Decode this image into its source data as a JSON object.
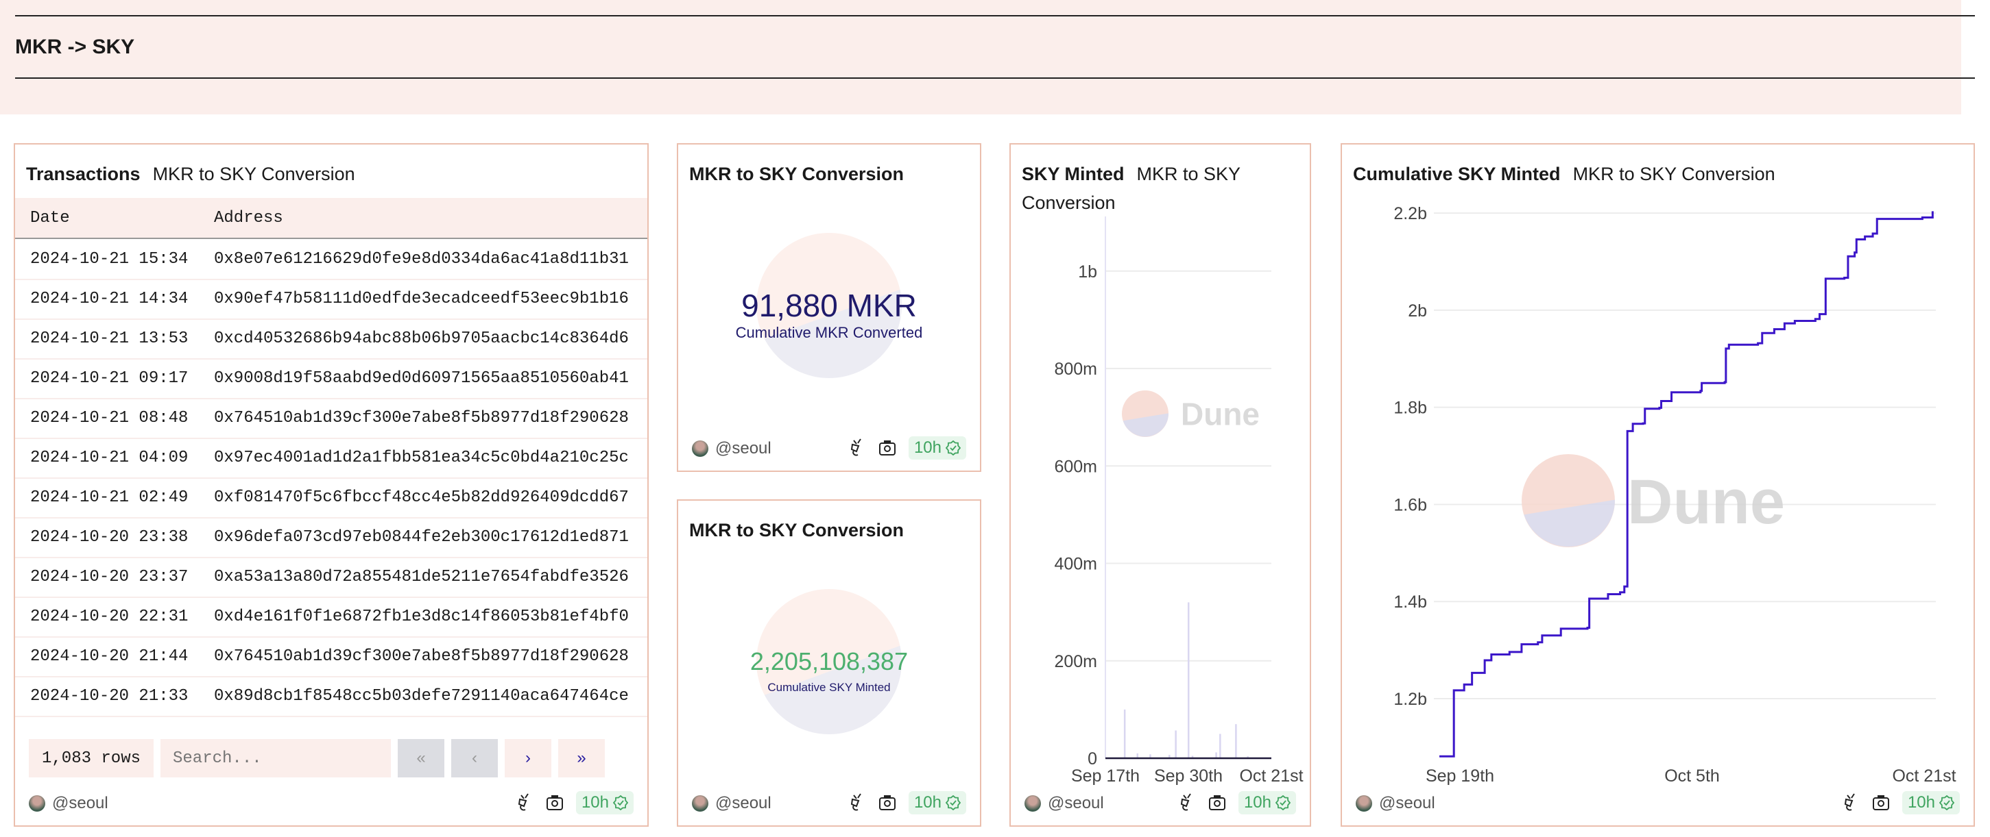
{
  "header": {
    "title": "MKR -> SKY"
  },
  "colors": {
    "accent": "#2a1fa0",
    "line": "#3b16c9",
    "bar": "#d9d6f0",
    "green": "#4caf6e",
    "navy": "#1f1a6b",
    "card_border": "#ebbfae",
    "header_bg": "#fbeeeb"
  },
  "table_card": {
    "title": "Transactions",
    "subtitle": "MKR to SKY Conversion",
    "columns": [
      "Date",
      "Address"
    ],
    "rows": [
      [
        "2024-10-21 15:34",
        "0x8e07e61216629d0fe9e8d0334da6ac41a8d11b31"
      ],
      [
        "2024-10-21 14:34",
        "0x90ef47b58111d0edfde3ecadceedf53eec9b1b16"
      ],
      [
        "2024-10-21 13:53",
        "0xcd40532686b94abc88b06b9705aacbc14c8364d6"
      ],
      [
        "2024-10-21 09:17",
        "0x9008d19f58aabd9ed0d60971565aa8510560ab41"
      ],
      [
        "2024-10-21 08:48",
        "0x764510ab1d39cf300e7abe8f5b8977d18f290628"
      ],
      [
        "2024-10-21 04:09",
        "0x97ec4001ad1d2a1fbb581ea34c5c0bd4a210c25c"
      ],
      [
        "2024-10-21 02:49",
        "0xf081470f5c6fbccf48cc4e5b82dd926409dcdd67"
      ],
      [
        "2024-10-20 23:38",
        "0x96defa073cd97eb0844fe2eb300c17612d1ed871"
      ],
      [
        "2024-10-20 23:37",
        "0xa53a13a80d72a855481de5211e7654fabdfe3526"
      ],
      [
        "2024-10-20 22:31",
        "0xd4e161f0f1e6872fb1e3d8c14f86053b81ef4bf0"
      ],
      [
        "2024-10-20 21:44",
        "0x764510ab1d39cf300e7abe8f5b8977d18f290628"
      ],
      [
        "2024-10-20 21:33",
        "0x89d8cb1f8548cc5b03defe7291140aca647464ce"
      ]
    ],
    "row_count": "1,083 rows",
    "search_placeholder": "Search...",
    "pager": {
      "first": "«",
      "prev": "‹",
      "next": "›",
      "last": "»"
    },
    "author": "@seoul",
    "freshness": "10h"
  },
  "counter1": {
    "title": "MKR to SKY Conversion",
    "value": "91,880 MKR",
    "label": "Cumulative MKR Converted",
    "author": "@seoul",
    "freshness": "10h"
  },
  "counter2": {
    "title": "MKR to SKY Conversion",
    "value": "2,205,108,387",
    "label": "Cumulative SKY Minted",
    "author": "@seoul",
    "freshness": "10h"
  },
  "sky_minted": {
    "title": "SKY Minted",
    "subtitle": "MKR to SKY Conversion",
    "author": "@seoul",
    "freshness": "10h",
    "watermark": "Dune"
  },
  "cumulative": {
    "title": "Cumulative SKY Minted",
    "subtitle": "MKR to SKY Conversion",
    "author": "@seoul",
    "freshness": "10h",
    "watermark": "Dune"
  },
  "chart_data": [
    {
      "type": "bar",
      "title": "SKY Minted",
      "ylim": [
        0,
        1070000000
      ],
      "yticks": [
        {
          "v": 0,
          "label": "0"
        },
        {
          "v": 200000000,
          "label": "200m"
        },
        {
          "v": 400000000,
          "label": "400m"
        },
        {
          "v": 600000000,
          "label": "600m"
        },
        {
          "v": 800000000,
          "label": "800m"
        },
        {
          "v": 1000000000,
          "label": "1b"
        }
      ],
      "xticks": [
        {
          "date": "2024-09-17",
          "label": "Sep 17th"
        },
        {
          "date": "2024-09-30",
          "label": "Sep 30th"
        },
        {
          "date": "2024-10-21",
          "label": "Oct 21st"
        }
      ],
      "grid": true,
      "bars": [
        [
          "2024-09-20",
          100000000
        ],
        [
          "2024-09-22",
          10000000
        ],
        [
          "2024-09-24",
          8000000
        ],
        [
          "2024-09-27",
          7000000
        ],
        [
          "2024-09-28",
          57000000
        ],
        [
          "2024-09-30",
          320000000
        ],
        [
          "2024-10-01",
          5000000
        ],
        [
          "2024-10-07",
          12000000
        ],
        [
          "2024-10-08",
          50000000
        ],
        [
          "2024-10-12",
          70000000
        ],
        [
          "2024-10-15",
          4000000
        ]
      ]
    },
    {
      "type": "line",
      "title": "Cumulative SKY Minted",
      "interpolation": "step",
      "ylim": [
        1080000000,
        2220000000
      ],
      "yticks": [
        {
          "v": 1200000000,
          "label": "1.2b"
        },
        {
          "v": 1400000000,
          "label": "1.4b"
        },
        {
          "v": 1600000000,
          "label": "1.6b"
        },
        {
          "v": 1800000000,
          "label": "1.8b"
        },
        {
          "v": 2000000000,
          "label": "2b"
        },
        {
          "v": 2200000000,
          "label": "2.2b"
        }
      ],
      "xticks": [
        {
          "date": "2024-09-19",
          "label": "Sep 19th"
        },
        {
          "date": "2024-10-05",
          "label": "Oct 5th"
        },
        {
          "date": "2024-10-21",
          "label": "Oct 21st"
        }
      ],
      "grid": true,
      "points": [
        [
          "2024-09-17T14:00",
          1081000000
        ],
        [
          "2024-09-18T14:00",
          1107000000
        ],
        [
          "2024-09-18T14:00",
          1217000000
        ],
        [
          "2024-09-19T07:00",
          1229000000
        ],
        [
          "2024-09-19T20:00",
          1253000000
        ],
        [
          "2024-09-20T17:00",
          1279000000
        ],
        [
          "2024-09-21T04:00",
          1291000000
        ],
        [
          "2024-09-22T10:00",
          1296000000
        ],
        [
          "2024-09-23T06:00",
          1312000000
        ],
        [
          "2024-09-24T09:00",
          1316000000
        ],
        [
          "2024-09-24T16:00",
          1330000000
        ],
        [
          "2024-09-25T23:00",
          1344000000
        ],
        [
          "2024-09-27T19:00",
          1346000000
        ],
        [
          "2024-09-27T22:00",
          1406000000
        ],
        [
          "2024-09-29T05:00",
          1415000000
        ],
        [
          "2024-09-30T01:00",
          1419000000
        ],
        [
          "2024-09-30T08:00",
          1431000000
        ],
        [
          "2024-09-30T13:00",
          1751000000
        ],
        [
          "2024-09-30T22:00",
          1766000000
        ],
        [
          "2024-10-01T15:00",
          1767000000
        ],
        [
          "2024-10-01T18:00",
          1797000000
        ],
        [
          "2024-10-02T18:00",
          1799000000
        ],
        [
          "2024-10-02T21:00",
          1813000000
        ],
        [
          "2024-10-03T14:00",
          1831000000
        ],
        [
          "2024-10-05T14:00",
          1834000000
        ],
        [
          "2024-10-05T16:00",
          1850000000
        ],
        [
          "2024-10-07T06:00",
          1852000000
        ],
        [
          "2024-10-07T08:00",
          1921000000
        ],
        [
          "2024-10-07T13:00",
          1929000000
        ],
        [
          "2024-10-09T13:00",
          1932000000
        ],
        [
          "2024-10-09T20:00",
          1953000000
        ],
        [
          "2024-10-10T16:00",
          1961000000
        ],
        [
          "2024-10-11T09:00",
          1973000000
        ],
        [
          "2024-10-12T02:00",
          1978000000
        ],
        [
          "2024-10-13T12:00",
          1982000000
        ],
        [
          "2024-10-13T19:00",
          1992000000
        ],
        [
          "2024-10-14T05:00",
          2065000000
        ],
        [
          "2024-10-15T12:00",
          2067000000
        ],
        [
          "2024-10-15T18:00",
          2111000000
        ],
        [
          "2024-10-16T05:00",
          2119000000
        ],
        [
          "2024-10-16T08:00",
          2146000000
        ],
        [
          "2024-10-16T22:00",
          2152000000
        ],
        [
          "2024-10-17T11:00",
          2158000000
        ],
        [
          "2024-10-17T18:00",
          2188000000
        ],
        [
          "2024-10-20T21:00",
          2191000000
        ],
        [
          "2024-10-21T14:00",
          2204000000
        ]
      ]
    }
  ]
}
